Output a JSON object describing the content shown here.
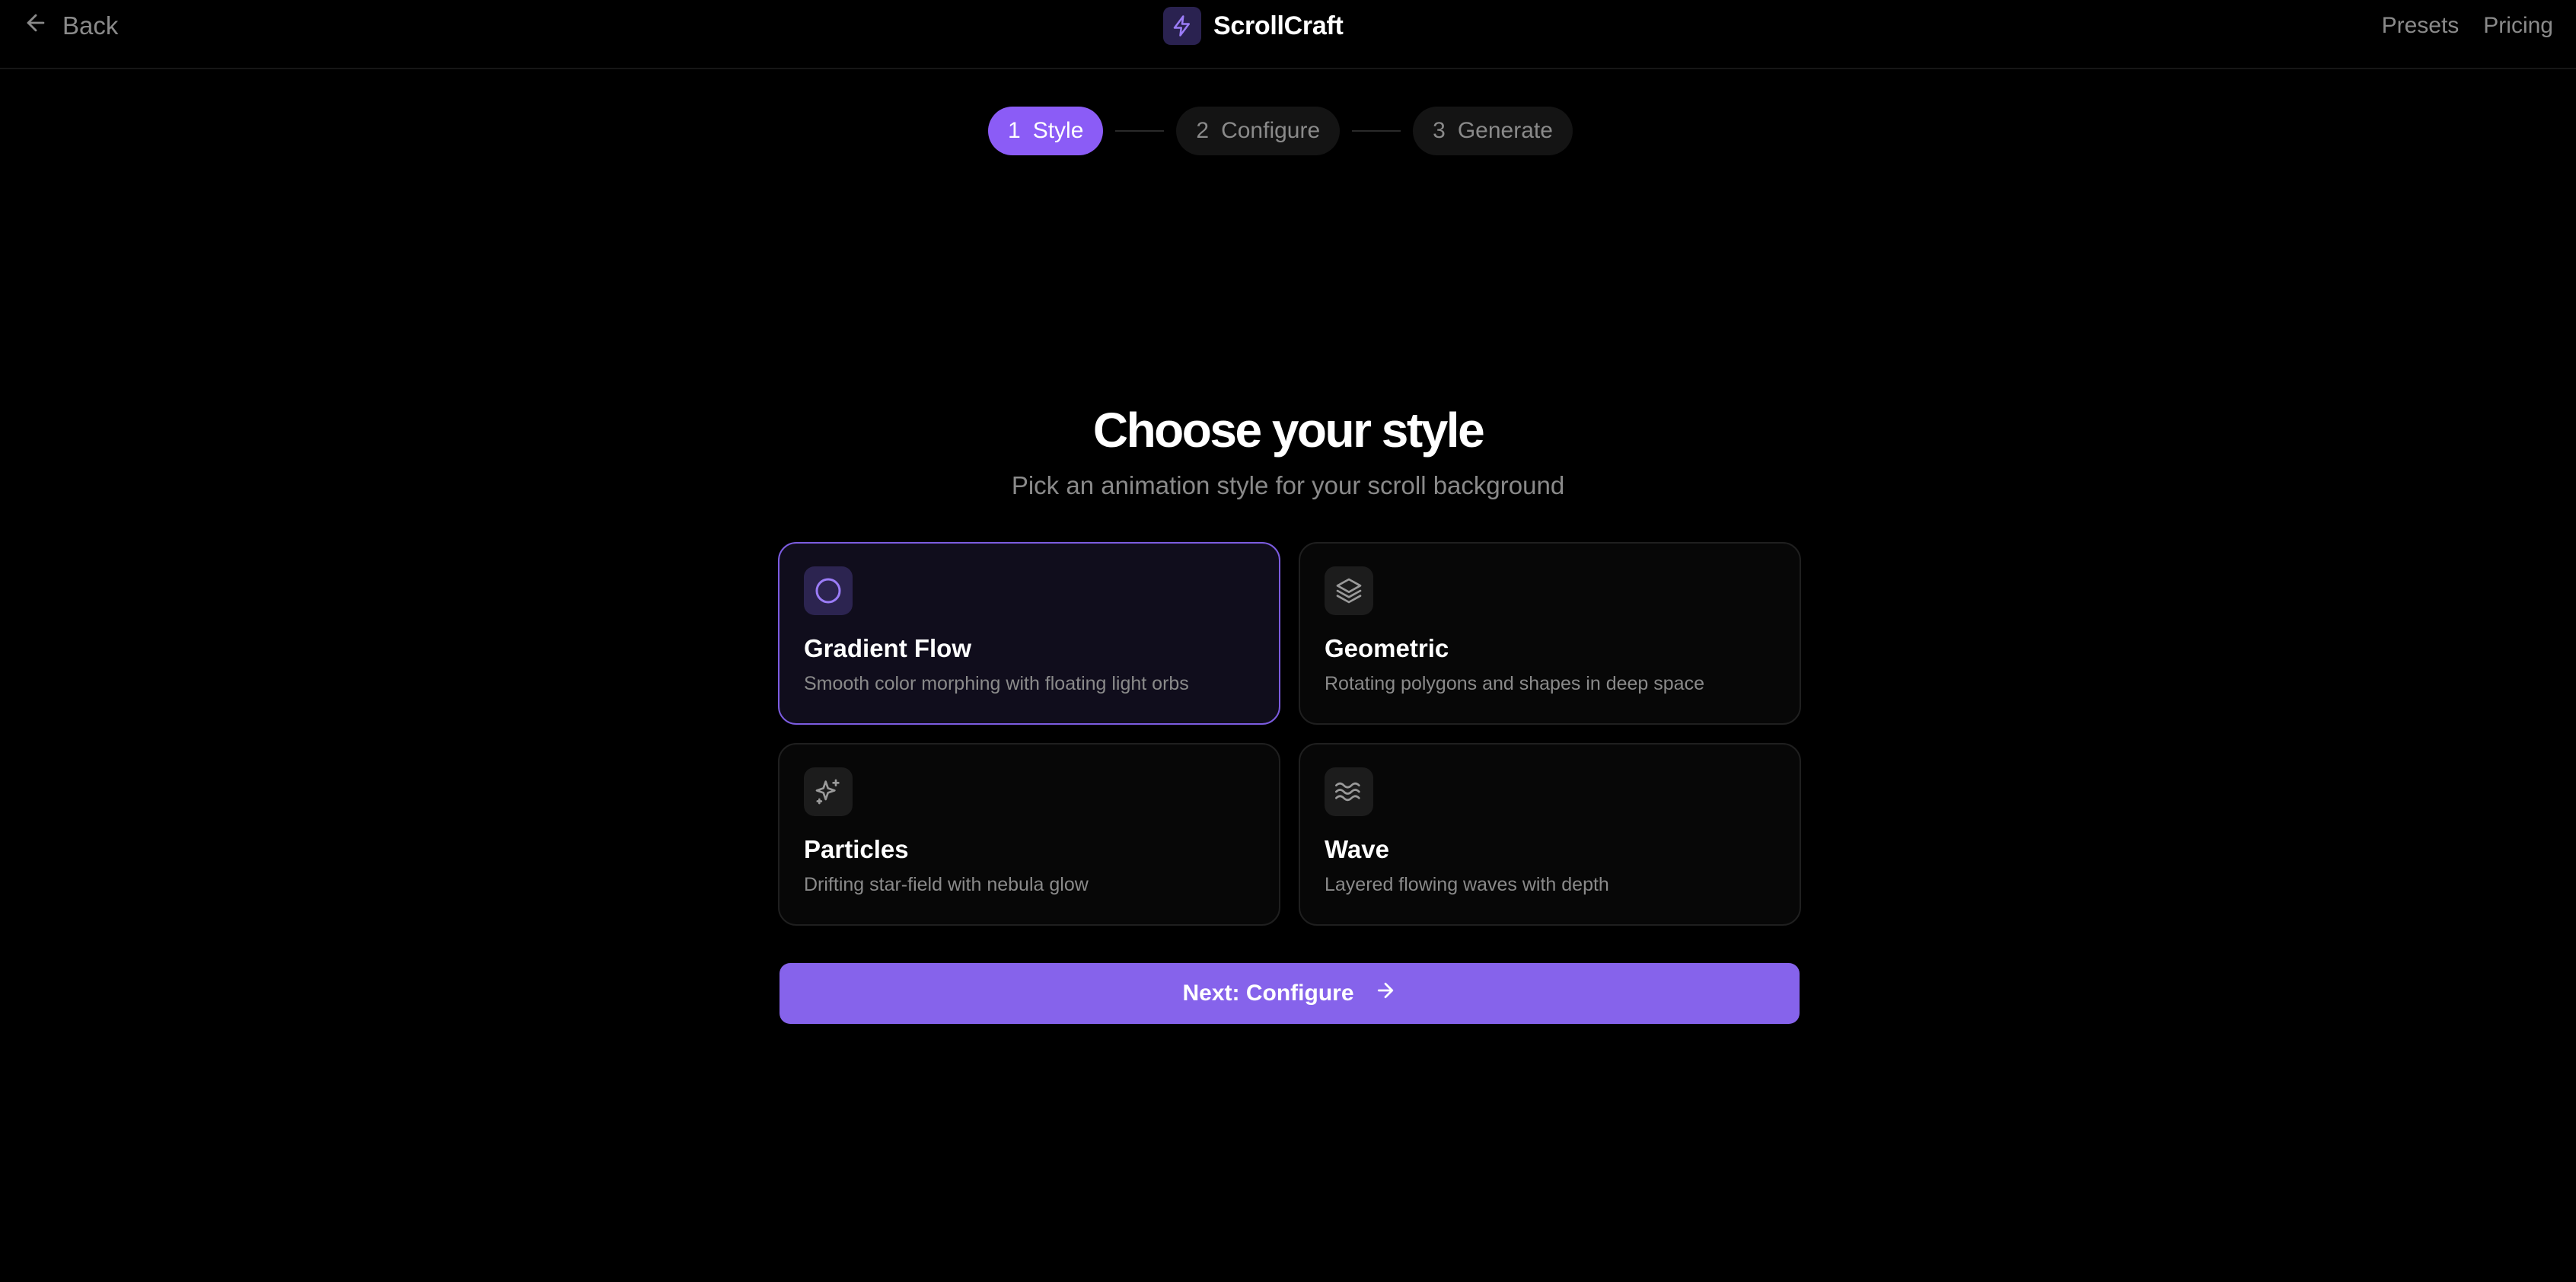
{
  "header": {
    "back_label": "Back",
    "app_name": "ScrollCraft",
    "nav": [
      "Presets",
      "Pricing"
    ]
  },
  "stepper": {
    "steps": [
      {
        "number": "1",
        "label": "Style",
        "active": true
      },
      {
        "number": "2",
        "label": "Configure",
        "active": false
      },
      {
        "number": "3",
        "label": "Generate",
        "active": false
      }
    ]
  },
  "main": {
    "title": "Choose your style",
    "subtitle": "Pick an animation style for your scroll background",
    "styles": [
      {
        "title": "Gradient Flow",
        "description": "Smooth color morphing with floating light orbs",
        "icon": "circle-icon",
        "selected": true
      },
      {
        "title": "Geometric",
        "description": "Rotating polygons and shapes in deep space",
        "icon": "layers-icon",
        "selected": false
      },
      {
        "title": "Particles",
        "description": "Drifting star-field with nebula glow",
        "icon": "sparkles-icon",
        "selected": false
      },
      {
        "title": "Wave",
        "description": "Layered flowing waves with depth",
        "icon": "waves-icon",
        "selected": false
      }
    ],
    "next_label": "Next: Configure"
  },
  "colors": {
    "accent": "#8b5cf6",
    "button": "#8663eb",
    "background": "#000000",
    "muted_text": "#8a8a8a"
  }
}
